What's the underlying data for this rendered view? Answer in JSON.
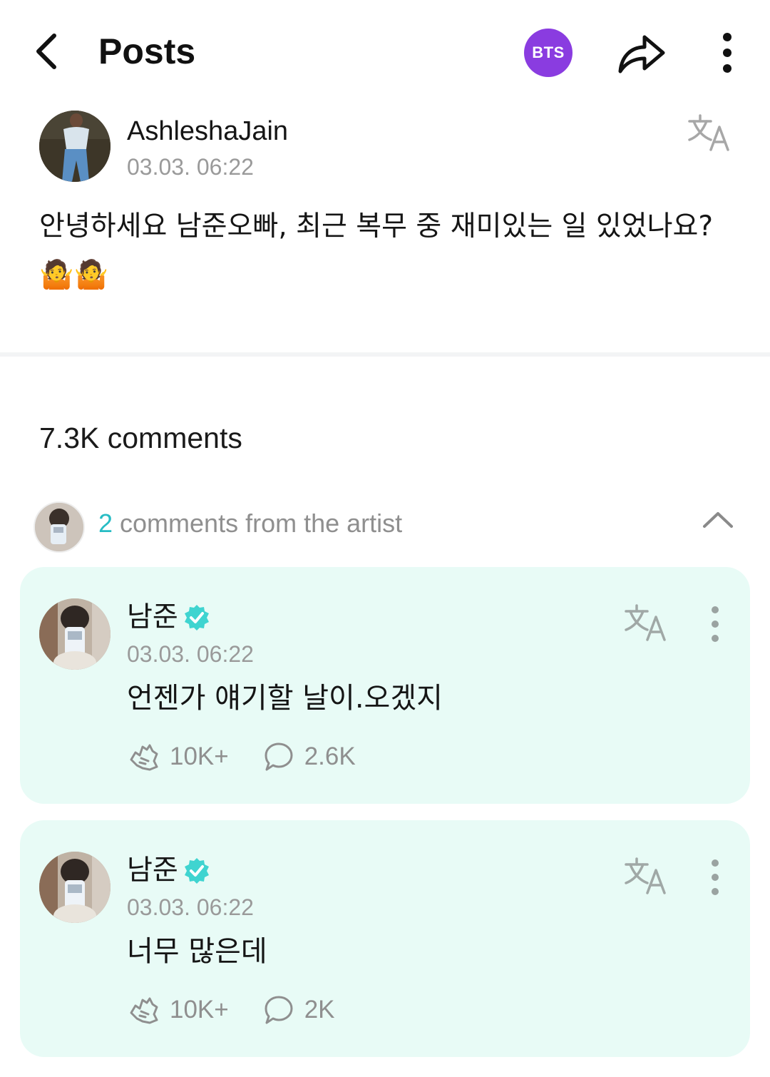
{
  "header": {
    "title": "Posts",
    "community_badge": "BTS",
    "colors": {
      "badge": "#8a3ce0"
    }
  },
  "post": {
    "author": "AshleshaJain",
    "time": "03.03. 06:22",
    "body": "안녕하세요 남준오빠, 최근 복무 중 재미있는 일 있었나요? 🤷🤷"
  },
  "comments": {
    "count_label": "7.3K comments",
    "artist_section": {
      "count": "2",
      "label": " comments from the artist"
    },
    "items": [
      {
        "name": "남준",
        "time": "03.03. 06:22",
        "text": "언젠가 얘기할 날이.오겠지",
        "likes": "10K+",
        "replies": "2.6K"
      },
      {
        "name": "남준",
        "time": "03.03. 06:22",
        "text": "너무 많은데",
        "likes": "10K+",
        "replies": "2K"
      }
    ]
  },
  "icons": [
    "back-icon",
    "share-icon",
    "more-vertical-icon",
    "translate-icon",
    "chevron-up-icon",
    "verified-icon",
    "cheer-icon",
    "comment-bubble-icon"
  ],
  "colors": {
    "accent_teal": "#27bcc4",
    "card_bg": "#e8fbf6",
    "muted_text": "#8f8f8f"
  }
}
